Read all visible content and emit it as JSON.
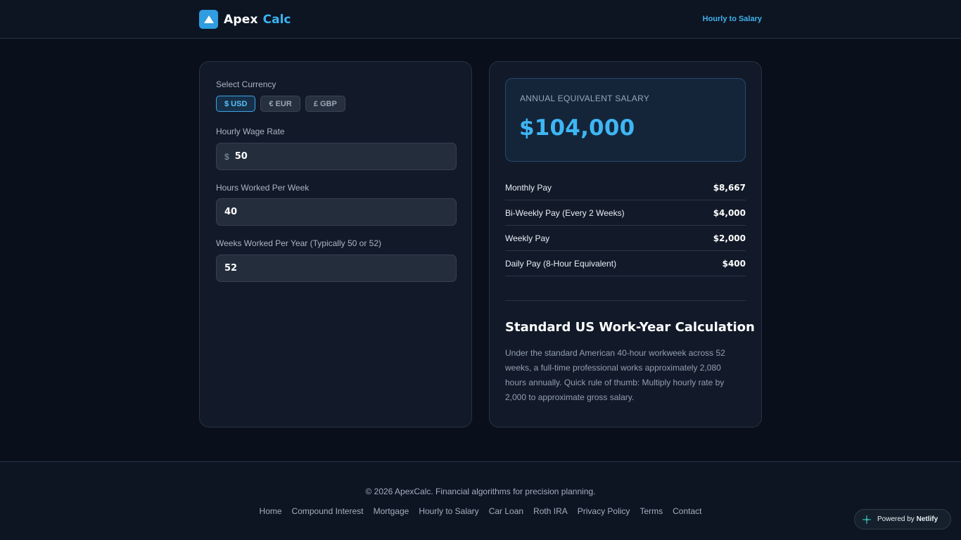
{
  "header": {
    "brand_name": "Apex",
    "brand_accent": "Calc",
    "nav_link": "Hourly to Salary"
  },
  "form": {
    "currency_label": "Select Currency",
    "currencies": [
      "$ USD",
      "€ EUR",
      "£ GBP"
    ],
    "selected_currency": "$ USD",
    "hourly_label": "Hourly Wage Rate",
    "hourly_prefix": "$",
    "hourly_value": "50",
    "hours_label": "Hours Worked Per Week",
    "hours_value": "40",
    "weeks_label": "Weeks Worked Per Year (Typically 50 or 52)",
    "weeks_value": "52"
  },
  "results": {
    "annual_label": "ANNUAL EQUIVALENT SALARY",
    "annual_value": "$104,000",
    "rows": [
      {
        "label": "Monthly Pay",
        "value": "$8,667"
      },
      {
        "label": "Bi-Weekly Pay (Every 2 Weeks)",
        "value": "$4,000"
      },
      {
        "label": "Weekly Pay",
        "value": "$2,000"
      },
      {
        "label": "Daily Pay (8-Hour Equivalent)",
        "value": "$400"
      }
    ],
    "info_title": "Standard US Work-Year Calculation",
    "info_text": "Under the standard American 40-hour workweek across 52 weeks, a full-time professional works approximately 2,080 hours annually. Quick rule of thumb: Multiply hourly rate by 2,000 to approximate gross salary."
  },
  "footer": {
    "copyright": "© 2026 ApexCalc. Financial algorithms for precision planning.",
    "links": [
      "Home",
      "Compound Interest",
      "Mortgage",
      "Hourly to Salary",
      "Car Loan",
      "Roth IRA",
      "Privacy Policy",
      "Terms",
      "Contact"
    ]
  },
  "badge": {
    "prefix": "Powered by",
    "name": "Netlify"
  },
  "colors": {
    "accent": "#38b6f2",
    "background": "#0a101b",
    "card": "#121a29"
  }
}
